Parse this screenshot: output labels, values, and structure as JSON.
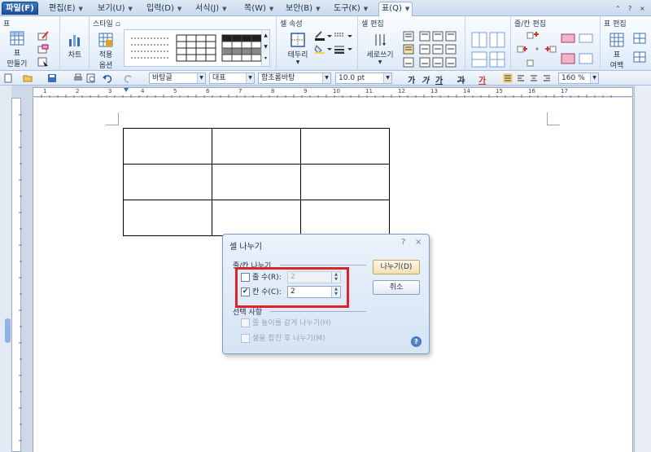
{
  "menu": {
    "items": [
      {
        "label": "파일(F)"
      },
      {
        "label": "편집(E)"
      },
      {
        "label": "보기(U)"
      },
      {
        "label": "입력(D)"
      },
      {
        "label": "서식(J)"
      },
      {
        "label": "쪽(W)"
      },
      {
        "label": "보안(B)"
      },
      {
        "label": "도구(K)"
      },
      {
        "label": "표(Q)"
      }
    ],
    "help": "?",
    "close": "×",
    "restore": "⌃"
  },
  "ribbon": {
    "groups": {
      "table": "표",
      "style": "스타일",
      "cell_props": "셀 속성",
      "cell_edit": "셀 편집",
      "rowcol_edit": "줄/칸 편집",
      "table_edit": "표 편집"
    },
    "buttons": {
      "make_table_1": "표",
      "make_table_2": "만들기",
      "chart": "차트",
      "apply_1": "적용",
      "apply_2": "옵션",
      "border": "테두리",
      "vertical": "세로쓰기",
      "margin_1": "표",
      "margin_2": "여백"
    }
  },
  "format": {
    "style": "바탕글",
    "lang": "대표",
    "font": "함초롬바탕",
    "size": "10.0",
    "unit": "pt",
    "bold": "가",
    "italic": "가",
    "underline": "가",
    "strike": "가",
    "color": "가",
    "zoom_label": "160",
    "zoom_unit": "%"
  },
  "ruler": {
    "marks": [
      "1",
      "2",
      "3",
      "4",
      "5",
      "6",
      "7",
      "8",
      "9",
      "10",
      "11",
      "12",
      "13",
      "14",
      "15",
      "16",
      "17"
    ]
  },
  "dialog": {
    "title": "셀 나누기",
    "help": "?",
    "close": "×",
    "section_rowcol": "줄/칸 나누기",
    "row_label": "줄 수(R):",
    "row_value": "2",
    "col_label": "칸 수(C):",
    "col_value": "2",
    "section_options": "선택 사항",
    "option_equal_height": "줄 높이를 같게 나누기(H)",
    "option_merge_first": "셀을 합친 후 나누기(M)",
    "ok_button": "나누기(D)",
    "cancel_button": "취소",
    "help_icon": "?"
  },
  "colors": {
    "accent": "#1d4f9c",
    "highlight": "#e0232a"
  }
}
